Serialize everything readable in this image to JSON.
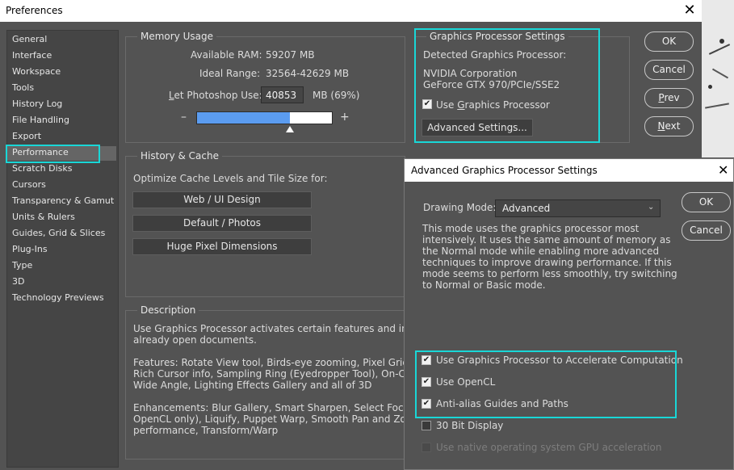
{
  "window": {
    "title": "Preferences",
    "close_glyph": "✕"
  },
  "sidebar": {
    "items": [
      "General",
      "Interface",
      "Workspace",
      "Tools",
      "History Log",
      "File Handling",
      "Export",
      "Performance",
      "Scratch Disks",
      "Cursors",
      "Transparency & Gamut",
      "Units & Rulers",
      "Guides, Grid & Slices",
      "Plug-Ins",
      "Type",
      "3D",
      "Technology Previews"
    ],
    "selected": "Performance"
  },
  "memory": {
    "title": "Memory Usage",
    "available_label": "Available RAM:",
    "available_value": "59207 MB",
    "ideal_label": "Ideal Range:",
    "ideal_value": "32564-42629 MB",
    "let_label_prefix": "L",
    "let_label_rest": "et Photoshop Use:",
    "let_value": "40853",
    "let_unit": "MB (69%)",
    "minus": "–",
    "plus": "+",
    "slider_fraction": 0.69
  },
  "gpu": {
    "title": "Graphics Processor Settings",
    "detected_label": "Detected Graphics Processor:",
    "vendor": "NVIDIA Corporation",
    "model": "GeForce GTX 970/PCIe/SSE2",
    "use_label_pre": "Use ",
    "use_label_u": "G",
    "use_label_post": "raphics Processor",
    "use_checked": true,
    "advanced_button": "Advanced Settings..."
  },
  "side_buttons": {
    "ok": "OK",
    "cancel": "Cancel",
    "prev_u": "P",
    "prev_rest": "rev",
    "next_u": "N",
    "next_rest": "ext"
  },
  "history": {
    "title": "History & Cache",
    "optimize_label": "Optimize Cache Levels and Tile Size for:",
    "buttons": [
      "Web / UI Design",
      "Default / Photos",
      "Huge Pixel Dimensions"
    ]
  },
  "description": {
    "title": "Description",
    "lines": [
      "Use Graphics Processor activates certain features and interfa",
      "already open documents.",
      "",
      "Features: Rotate View tool, Birds-eye zooming, Pixel Grid, Flic",
      "Rich Cursor info, Sampling Ring (Eyedropper Tool), On-Canva",
      "Wide Angle, Lighting Effects Gallery and all of 3D",
      "",
      "Enhancements: Blur Gallery, Smart Sharpen, Select Focus Are",
      "OpenCL only), Liquify, Puppet Warp, Smooth Pan and Zoom,",
      "performance, Transform/Warp"
    ]
  },
  "advanced": {
    "title": "Advanced Graphics Processor Settings",
    "close_glyph": "✕",
    "drawing_mode_label": "Drawing Mode:",
    "drawing_mode_value": "Advanced",
    "ok": "OK",
    "cancel": "Cancel",
    "desc_lines": [
      "This mode uses the graphics processor most",
      "intensively.  It uses the same amount of memory as",
      "the Normal mode while enabling more advanced",
      "techniques to improve drawing performance.  If this",
      "mode seems to perform less smoothly, try switching",
      "to Normal or Basic mode."
    ],
    "options": [
      {
        "label": "Use Graphics Processor to Accelerate Computation",
        "checked": true,
        "disabled": false
      },
      {
        "label": "Use OpenCL",
        "checked": true,
        "disabled": false
      },
      {
        "label": "Anti-alias Guides and Paths",
        "checked": true,
        "disabled": false
      },
      {
        "label": "30 Bit Display",
        "checked": false,
        "disabled": false
      },
      {
        "label": "Use native operating system GPU acceleration",
        "checked": false,
        "disabled": true
      }
    ]
  },
  "colors": {
    "highlight": "#19d7d7",
    "panel": "#535353",
    "slider_fill": "#5b9cf0"
  }
}
